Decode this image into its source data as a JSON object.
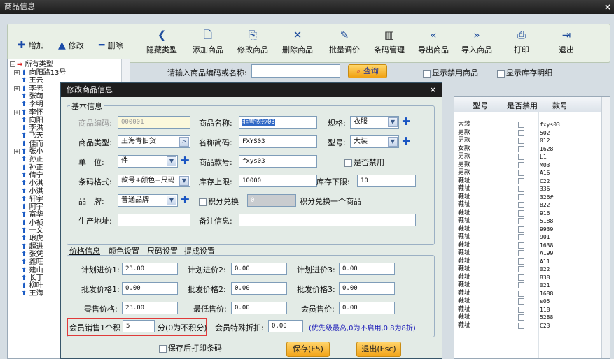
{
  "window": {
    "title": "商品信息",
    "close": "×"
  },
  "toolbar": {
    "add": "增加",
    "edit": "修改",
    "delete": "删除",
    "items": [
      "隐藏类型",
      "添加商品",
      "修改商品",
      "删除商品",
      "批量调价",
      "条码管理",
      "导出商品",
      "导入商品",
      "打印",
      "退出"
    ]
  },
  "tree": {
    "root": "所有类型",
    "nodes": [
      "向阳路13号",
      "王云",
      "李老",
      "张萌",
      "李明",
      "李怀",
      "向阳",
      "李洪",
      "飞天",
      "佳而",
      "张小",
      "孙正",
      "孙正",
      "倩宁",
      "小淇",
      "小淇",
      "轩宇",
      "阿宇",
      "富华",
      "小祯",
      "一文",
      "琅虎",
      "超进",
      "张凭",
      "鑫旺",
      "建山",
      "长丁",
      "柳叶",
      "王海"
    ]
  },
  "search": {
    "label": "请输入商品编码或名称:",
    "button": "查询",
    "show_disabled": "显示禁用商品",
    "show_stock": "显示库存明细"
  },
  "grid": {
    "headers": [
      "型号",
      "是否禁用",
      "款号"
    ],
    "rows": [
      {
        "type": "大装",
        "code": "fxys03"
      },
      {
        "type": "男款",
        "code": "502"
      },
      {
        "type": "男款",
        "code": "012"
      },
      {
        "type": "女款",
        "code": "1628"
      },
      {
        "type": "男款",
        "code": "L1"
      },
      {
        "type": "男款",
        "code": "M03"
      },
      {
        "type": "男款",
        "code": "A16"
      },
      {
        "type": "鞋址",
        "code": "C22"
      },
      {
        "type": "鞋址",
        "code": "336"
      },
      {
        "type": "鞋址",
        "code": "326#"
      },
      {
        "type": "鞋址",
        "code": "822"
      },
      {
        "type": "鞋址",
        "code": "916"
      },
      {
        "type": "鞋址",
        "code": "5188"
      },
      {
        "type": "鞋址",
        "code": "9939"
      },
      {
        "type": "鞋址",
        "code": "901"
      },
      {
        "type": "鞋址",
        "code": "1638"
      },
      {
        "type": "鞋址",
        "code": "A199"
      },
      {
        "type": "鞋址",
        "code": "A11"
      },
      {
        "type": "鞋址",
        "code": "022"
      },
      {
        "type": "鞋址",
        "code": "838"
      },
      {
        "type": "鞋址",
        "code": "021"
      },
      {
        "type": "鞋址",
        "code": "1688"
      },
      {
        "type": "鞋址",
        "code": "s05"
      },
      {
        "type": "鞋址",
        "code": "118"
      },
      {
        "type": "鞋址",
        "code": "5288"
      },
      {
        "type": "鞋址",
        "code": "C23"
      }
    ]
  },
  "dialog": {
    "title": "修改商品信息",
    "close": "×",
    "group": "基本信息",
    "code_label": "商品编码:",
    "code": "000001",
    "name_label": "商品名称:",
    "name": "菲雪依莎03",
    "spec_label": "规格:",
    "spec": "衣服",
    "cat_label": "商品类型:",
    "cat": "王海青旧货",
    "cat_btn": ">",
    "short_label": "名称简码:",
    "short": "FXYS03",
    "model_label": "型号:",
    "model": "大装",
    "unit_label": "单　位:",
    "unit": "件",
    "style_label": "商品款号:",
    "style": "fxys03",
    "disable_label": "是否禁用",
    "barcode_label": "条码格式:",
    "barcode": "款号+颜色+尺码",
    "stock_up_label": "库存上限:",
    "stock_up": "10000",
    "stock_down_label": "库存下限:",
    "stock_down": "10",
    "brand_label": "品　牌:",
    "brand": "普通品牌",
    "points_label": "积分兑换",
    "points": "0",
    "points_suffix": "积分兑换一个商品",
    "addr_label": "生产地址:",
    "remark_label": "备注信息:",
    "tabs": [
      "价格信息",
      "颜色设置",
      "尺码设置",
      "提成设置"
    ],
    "prices": {
      "p1_label": "计划进价1:",
      "p1": "23.00",
      "p2_label": "计划进价2:",
      "p2": "0.00",
      "p3_label": "计划进价3:",
      "p3": "0.00",
      "w1_label": "批发价格1:",
      "w1": "0.00",
      "w2_label": "批发价格2:",
      "w2": "0.00",
      "w3_label": "批发价格3:",
      "w3": "0.00",
      "retail_label": "零售价格:",
      "retail": "23.00",
      "min_label": "最低售价:",
      "min": "0.00",
      "member_label": "会员售价:",
      "member": "0.00"
    },
    "member_points_label": "会员销售1个积",
    "member_points": "5",
    "member_points_suffix": "分(0为不积分)",
    "discount_label": "会员特殊折扣:",
    "discount": "0.00",
    "discount_note": "(优先级最高,0为不启用,0.8为8折)",
    "print_label": "保存后打印条码",
    "save": "保存(F5)",
    "exit": "退出(Esc)"
  }
}
